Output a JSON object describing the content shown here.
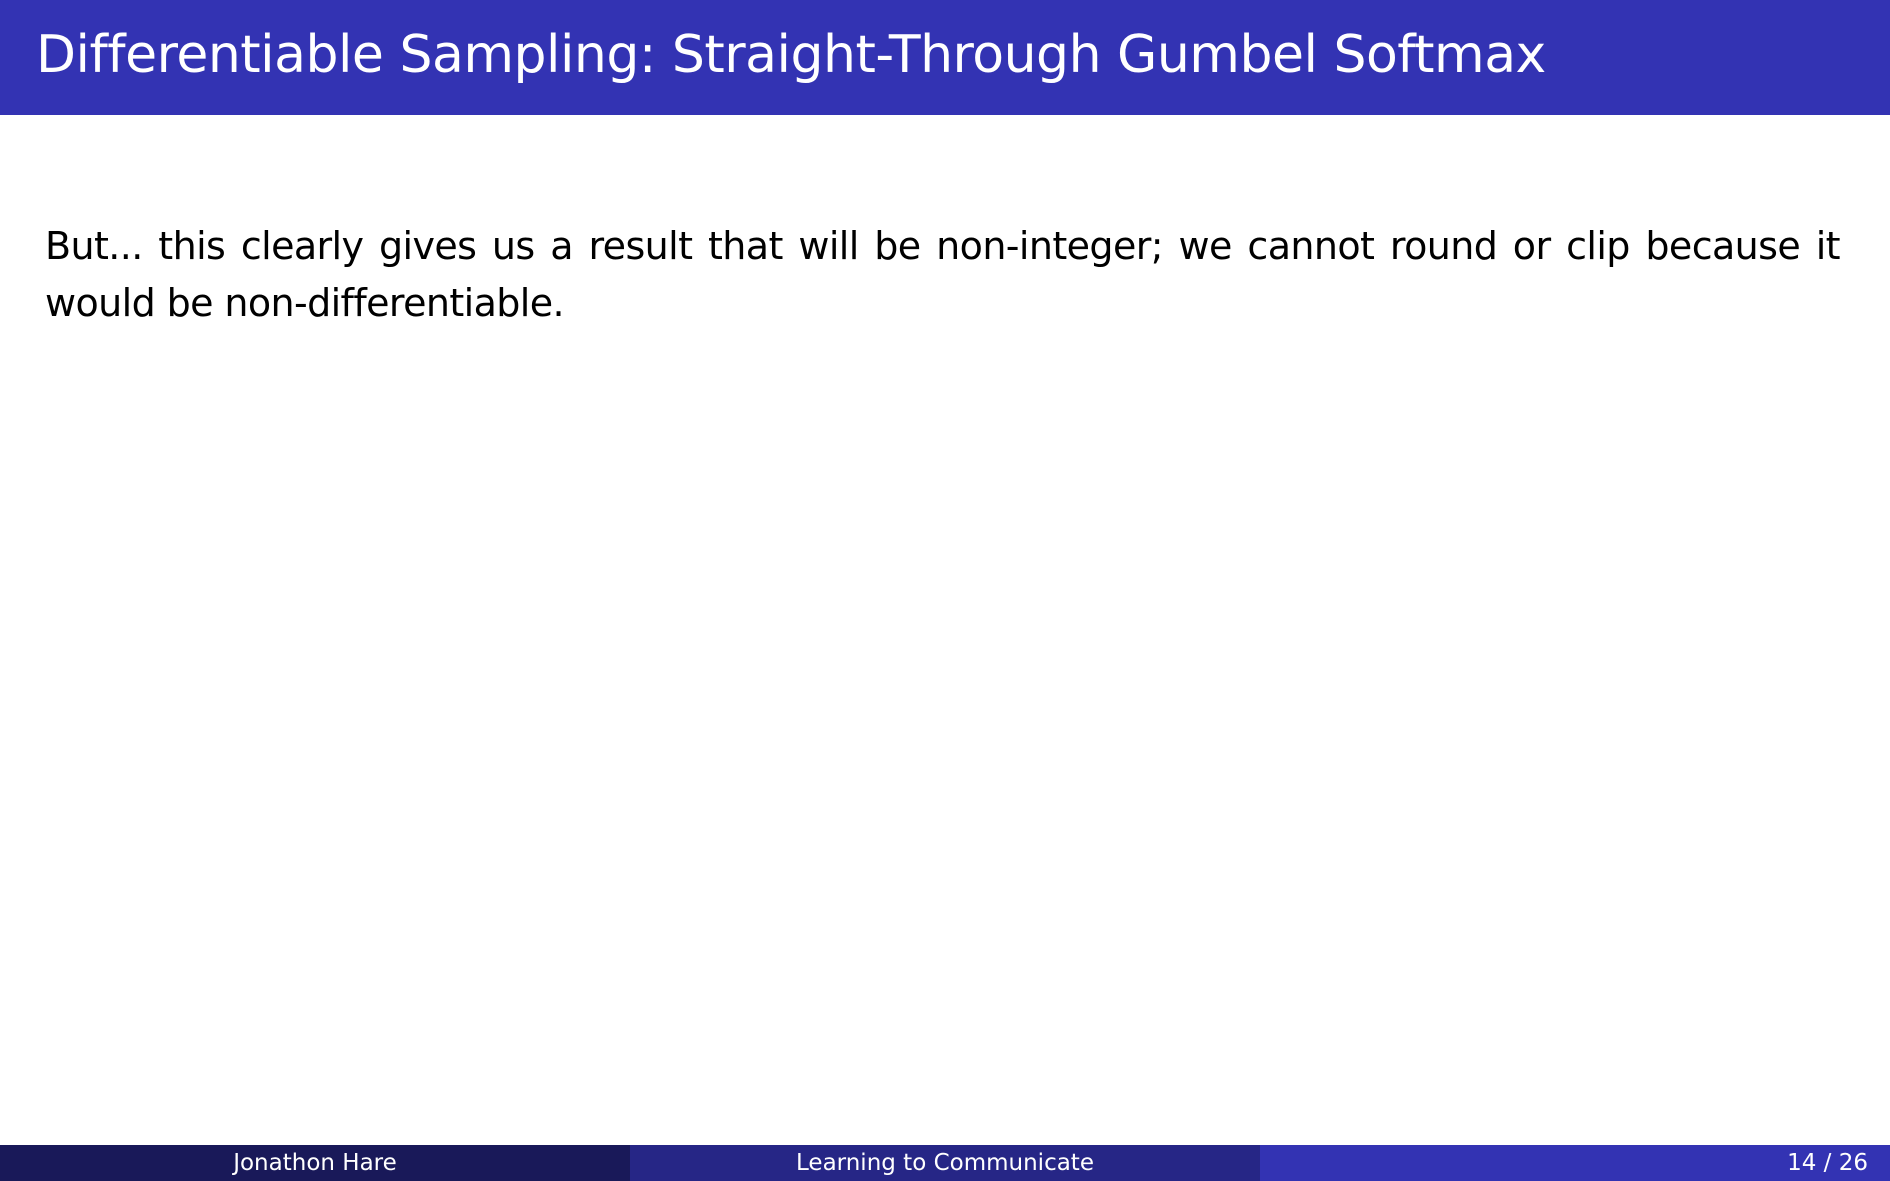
{
  "slide": {
    "title": "Differentiable Sampling: Straight-Through Gumbel Softmax",
    "body": "But... this clearly gives us a result that will be non-integer; we cannot round or clip because it would be non-differentiable."
  },
  "footer": {
    "author": "Jonathon Hare",
    "talk_title": "Learning to Communicate",
    "page": "14 / 26"
  },
  "colors": {
    "title_bar": "#3333b3",
    "footer_left": "#191959",
    "footer_middle": "#262686",
    "footer_right": "#3333b3"
  }
}
